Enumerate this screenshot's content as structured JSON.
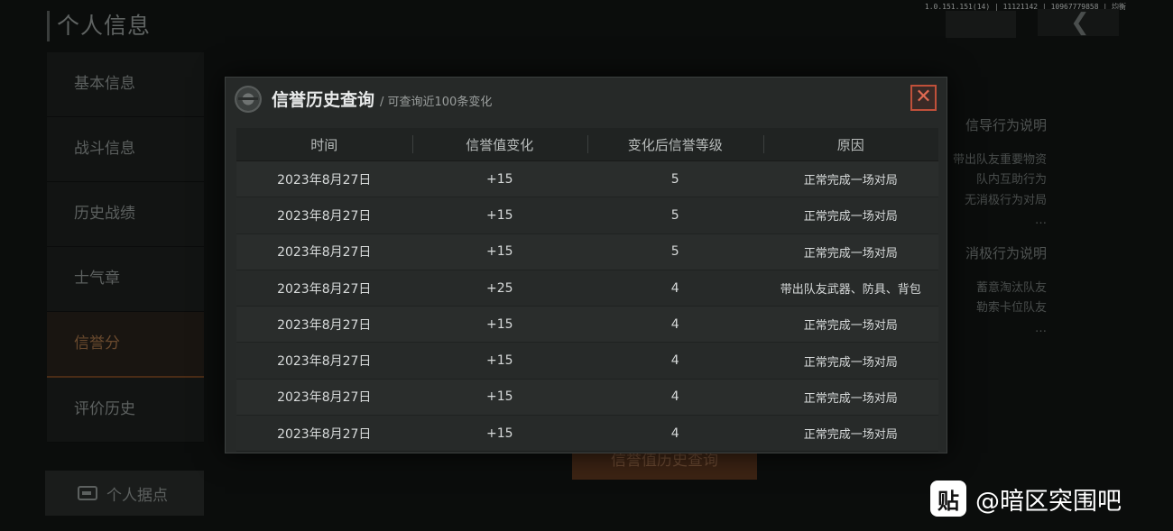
{
  "version": "1.0.151.151(14) | 11121142 | 10967779858 | 均衡",
  "page_title": "个人信息",
  "sidebar": {
    "items": [
      {
        "label": "基本信息"
      },
      {
        "label": "战斗信息"
      },
      {
        "label": "历史战绩"
      },
      {
        "label": "士气章"
      },
      {
        "label": "信誉分"
      },
      {
        "label": "评价历史"
      }
    ],
    "active_index": 4
  },
  "stronghold_button": "个人据点",
  "right_panel": {
    "positive_title": "信导行为说明",
    "positive_items": [
      "带出队友重要物资",
      "队内互助行为",
      "无消极行为对局",
      "…"
    ],
    "negative_title": "消极行为说明",
    "negative_items": [
      "蓄意淘汰队友",
      "勒索卡位队友",
      "…"
    ]
  },
  "history_button": "信誉值历史查询",
  "modal": {
    "title": "信誉历史查询",
    "subtitle": "/ 可查询近100条变化",
    "close_symbol": "✕",
    "columns": [
      "时间",
      "信誉值变化",
      "变化后信誉等级",
      "原因"
    ],
    "rows": [
      {
        "time": "2023年8月27日",
        "change": "+15",
        "level": "5",
        "reason": "正常完成一场对局"
      },
      {
        "time": "2023年8月27日",
        "change": "+15",
        "level": "5",
        "reason": "正常完成一场对局"
      },
      {
        "time": "2023年8月27日",
        "change": "+15",
        "level": "5",
        "reason": "正常完成一场对局"
      },
      {
        "time": "2023年8月27日",
        "change": "+25",
        "level": "4",
        "reason": "带出队友武器、防具、背包"
      },
      {
        "time": "2023年8月27日",
        "change": "+15",
        "level": "4",
        "reason": "正常完成一场对局"
      },
      {
        "time": "2023年8月27日",
        "change": "+15",
        "level": "4",
        "reason": "正常完成一场对局"
      },
      {
        "time": "2023年8月27日",
        "change": "+15",
        "level": "4",
        "reason": "正常完成一场对局"
      },
      {
        "time": "2023年8月27日",
        "change": "+15",
        "level": "4",
        "reason": "正常完成一场对局"
      }
    ]
  },
  "watermark": {
    "logo_text": "贴",
    "text": "@暗区突围吧"
  }
}
